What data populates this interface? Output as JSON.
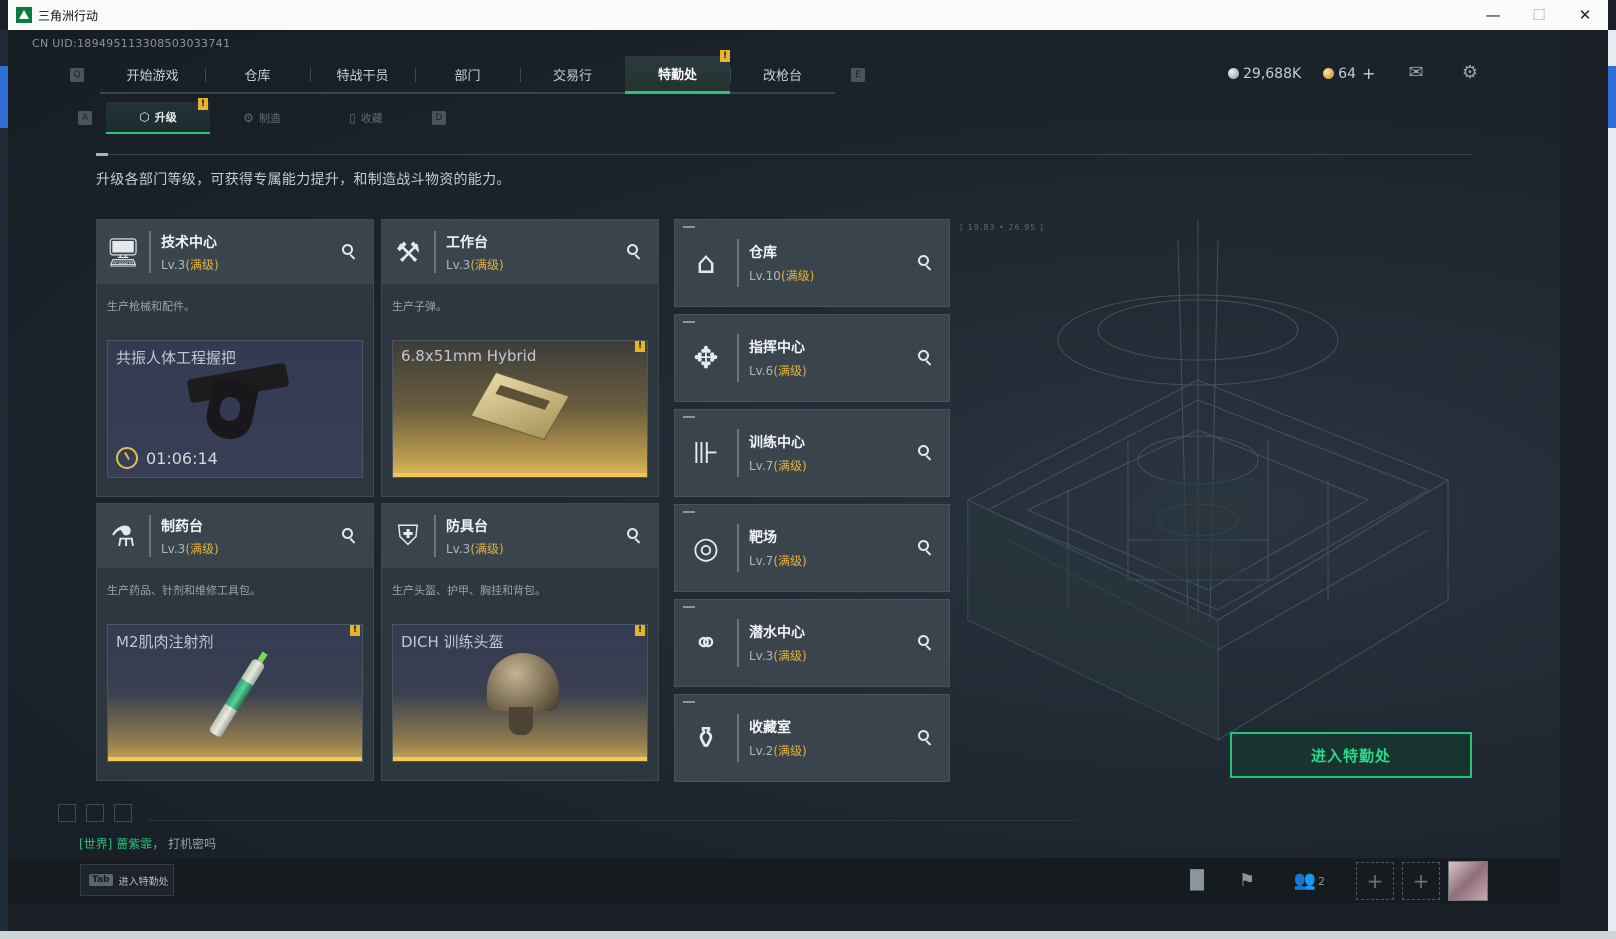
{
  "window": {
    "title": "三角洲行动",
    "controls": [
      "—",
      "☐",
      "✕"
    ]
  },
  "uid": "CN UID:18949511330850303374​1",
  "topnav": {
    "left_key": "Q",
    "right_key": "E",
    "tabs": [
      {
        "label": "开始游戏"
      },
      {
        "label": "仓库"
      },
      {
        "label": "特战干员"
      },
      {
        "label": "部门"
      },
      {
        "label": "交易行"
      },
      {
        "label": "特勤处",
        "active": true,
        "badge": "!"
      },
      {
        "label": "改枪台"
      }
    ]
  },
  "resources": {
    "currency1": "29,688K",
    "currency2": "64",
    "plus": "+"
  },
  "icons": {
    "mail": "mail-icon",
    "settings": "gear-icon"
  },
  "subnav": {
    "left_key": "A",
    "right_key": "D",
    "tabs": [
      {
        "label": "升级",
        "icon": "⬡",
        "active": true,
        "badge": "!"
      },
      {
        "label": "制造",
        "icon": "⚙"
      },
      {
        "label": "收藏",
        "icon": "▯"
      }
    ]
  },
  "description": "升级各部门等级，可获得专属能力提升，和制造战斗物资的能力。",
  "big_departments": [
    {
      "name": "技术中心",
      "level": "Lv.3",
      "max": "(满级)",
      "subtitle": "生产枪械和配件。",
      "icon": "🖥",
      "product": "共振人体工程握把",
      "timer": "01:06:14"
    },
    {
      "name": "工作台",
      "level": "Lv.3",
      "max": "(满级)",
      "subtitle": "生产子弹。",
      "icon": "⚒",
      "product": "6.8x51mm Hybrid",
      "badge": "!"
    },
    {
      "name": "制药台",
      "level": "Lv.3",
      "max": "(满级)",
      "subtitle": "生产药品、针剂和维修工具包。",
      "icon": "⚗",
      "product": "M2肌肉注射剂",
      "badge": "!"
    },
    {
      "name": "防具台",
      "level": "Lv.3",
      "max": "(满级)",
      "subtitle": "生产头盔、护甲、胸挂和背包。",
      "icon": "⛨",
      "product": "DICH 训练头盔",
      "badge": "!"
    }
  ],
  "small_departments": [
    {
      "name": "仓库",
      "level": "Lv.10",
      "max": "(满级)",
      "icon": "⌂"
    },
    {
      "name": "指挥中心",
      "level": "Lv.6",
      "max": "(满级)",
      "icon": "✥"
    },
    {
      "name": "训练中心",
      "level": "Lv.7",
      "max": "(满级)",
      "icon": "⊪"
    },
    {
      "name": "靶场",
      "level": "Lv.7",
      "max": "(满级)",
      "icon": "◎"
    },
    {
      "name": "潜水中心",
      "level": "Lv.3",
      "max": "(满级)",
      "icon": "⚭"
    },
    {
      "name": "收藏室",
      "level": "Lv.2",
      "max": "(满级)",
      "icon": "⚱"
    }
  ],
  "coord_label": "[ 19.83 • 26.95 ]",
  "enter_button": "进入特勤处",
  "chat": {
    "channel": "[世界]",
    "user": "蔷紫霏",
    "message": "打机密吗"
  },
  "bottom": {
    "tab_key": "Tab",
    "tab_label": "进入特勤处",
    "friend_count": "2"
  }
}
